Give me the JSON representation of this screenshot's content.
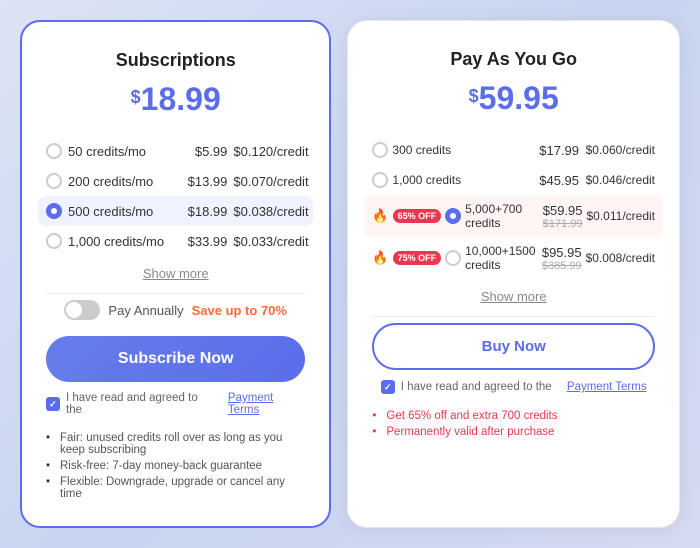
{
  "left": {
    "title": "Subscriptions",
    "price": "18.99",
    "price_symbol": "$",
    "plans": [
      {
        "id": "50mo",
        "name": "50 credits/mo",
        "price": "$5.99",
        "per_credit": "$0.120/credit",
        "selected": false
      },
      {
        "id": "200mo",
        "name": "200 credits/mo",
        "price": "$13.99",
        "per_credit": "$0.070/credit",
        "selected": false
      },
      {
        "id": "500mo",
        "name": "500 credits/mo",
        "price": "$18.99",
        "per_credit": "$0.038/credit",
        "selected": true
      },
      {
        "id": "1000mo",
        "name": "1,000 credits/mo",
        "price": "$33.99",
        "per_credit": "$0.033/credit",
        "selected": false
      }
    ],
    "show_more": "Show more",
    "toggle_label": "Pay Annually",
    "save_label": "Save up to 70%",
    "subscribe_btn": "Subscribe Now",
    "agree_text": "I have read and agreed to the",
    "agree_link": "Payment Terms",
    "bullets": [
      "Fair: unused credits roll over as long as you keep subscribing",
      "Risk-free: 7-day money-back guarantee",
      "Flexible: Downgrade, upgrade or cancel any time"
    ]
  },
  "right": {
    "title": "Pay As You Go",
    "price": "59.95",
    "price_symbol": "$",
    "plans": [
      {
        "id": "300",
        "name": "300 credits",
        "price": "$17.99",
        "per_credit": "$0.060/credit",
        "selected": false,
        "badge": null,
        "fire": false,
        "strike_price": null
      },
      {
        "id": "1000",
        "name": "1,000 credits",
        "price": "$45.95",
        "per_credit": "$0.046/credit",
        "selected": false,
        "badge": null,
        "fire": false,
        "strike_price": null
      },
      {
        "id": "5700",
        "name": "5,000+700 credits",
        "price": "$59.95",
        "per_credit": "$0.011/credit",
        "selected": true,
        "badge": "65% OFF",
        "fire": true,
        "strike_price": "$171.99"
      },
      {
        "id": "10001500",
        "name": "10,000+1500 credits",
        "price": "$95.95",
        "per_credit": "$0.008/credit",
        "selected": false,
        "badge": "75% OFF",
        "fire": true,
        "strike_price": "$385.99"
      }
    ],
    "show_more": "Show more",
    "buy_btn": "Buy Now",
    "agree_text": "I have read and agreed to the",
    "agree_link": "Payment Terms",
    "bullets": [
      "Get 65% off and extra 700 credits",
      "Permanently valid after purchase"
    ]
  }
}
